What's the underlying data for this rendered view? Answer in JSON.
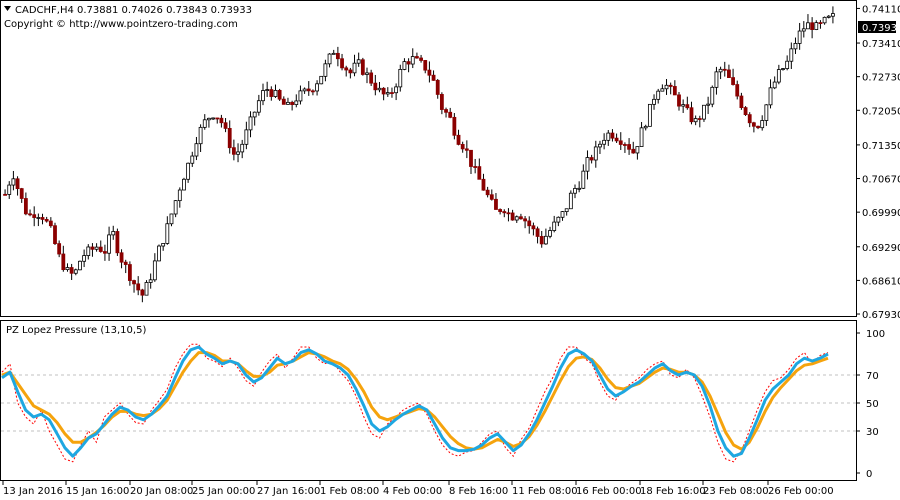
{
  "header": {
    "symbol_line": "CADCHF,H4  0.73881 0.74026 0.73843 0.73933",
    "copyright": "Copyright © http://www.pointzero-trading.com"
  },
  "price_badge": "0.73933",
  "indicator_title": "PZ Lopez Pressure (13,10,5)",
  "colors": {
    "candle_up": "#000000",
    "candle_down": "#8b0000",
    "fast_line": "#1ea7e1",
    "slow_line": "#f5a30d",
    "signal_dots": "#ff0000",
    "level_lines": "#c0c0c0"
  },
  "chart_data": [
    {
      "type": "candlestick",
      "title": "CADCHF,H4",
      "ohlc_last": {
        "open": 0.73881,
        "high": 0.74026,
        "low": 0.73843,
        "close": 0.73933
      },
      "ylim": [
        0.6789,
        0.7424
      ],
      "y_ticks": [
        "0.74110",
        "0.73410",
        "0.72730",
        "0.72050",
        "0.71350",
        "0.70670",
        "0.69990",
        "0.69290",
        "0.68610",
        "0.67930"
      ],
      "y_tick_values": [
        0.7411,
        0.7341,
        0.7273,
        0.7205,
        0.7135,
        0.7067,
        0.6999,
        0.6929,
        0.6861,
        0.6793
      ],
      "x_ticks": [
        "13 Jan 2016",
        "15 Jan 16:00",
        "20 Jan 08:00",
        "25 Jan 00:00",
        "27 Jan 16:00",
        "1 Feb 08:00",
        "4 Feb 00:00",
        "8 Feb 16:00",
        "11 Feb 08:00",
        "16 Feb 00:00",
        "18 Feb 16:00",
        "23 Feb 08:00",
        "26 Feb 00:00"
      ],
      "close_path": [
        0.7035,
        0.708,
        0.703,
        0.699,
        0.7,
        0.699,
        0.696,
        0.691,
        0.688,
        0.687,
        0.691,
        0.692,
        0.693,
        0.692,
        0.696,
        0.691,
        0.688,
        0.685,
        0.683,
        0.687,
        0.692,
        0.696,
        0.701,
        0.706,
        0.71,
        0.715,
        0.718,
        0.72,
        0.719,
        0.715,
        0.711,
        0.714,
        0.718,
        0.722,
        0.725,
        0.724,
        0.722,
        0.721,
        0.723,
        0.724,
        0.725,
        0.727,
        0.73,
        0.733,
        0.73,
        0.728,
        0.73,
        0.728,
        0.726,
        0.724,
        0.723,
        0.726,
        0.73,
        0.731,
        0.73,
        0.729,
        0.726,
        0.721,
        0.719,
        0.715,
        0.713,
        0.709,
        0.706,
        0.703,
        0.7,
        0.701,
        0.699,
        0.7,
        0.698,
        0.696,
        0.694,
        0.696,
        0.698,
        0.7,
        0.704,
        0.706,
        0.71,
        0.712,
        0.715,
        0.716,
        0.715,
        0.714,
        0.712,
        0.716,
        0.72,
        0.725,
        0.726,
        0.724,
        0.722,
        0.72,
        0.718,
        0.72,
        0.723,
        0.729,
        0.728,
        0.725,
        0.722,
        0.719,
        0.717,
        0.72,
        0.725,
        0.728,
        0.73,
        0.734,
        0.737,
        0.738,
        0.737,
        0.7385,
        0.7393
      ]
    },
    {
      "type": "line",
      "title": "PZ Lopez Pressure (13,10,5)",
      "ylim": [
        0,
        100
      ],
      "y_ticks": [
        "100",
        "70",
        "50",
        "30",
        "0"
      ],
      "y_tick_values": [
        100,
        70,
        50,
        30,
        0
      ],
      "levels": [
        70,
        50,
        30
      ],
      "series": [
        {
          "values": [
            68,
            72,
            58,
            45,
            40,
            42,
            38,
            28,
            18,
            12,
            18,
            25,
            28,
            35,
            42,
            47,
            45,
            40,
            38,
            42,
            48,
            55,
            68,
            80,
            88,
            90,
            85,
            82,
            78,
            80,
            78,
            70,
            65,
            68,
            75,
            82,
            78,
            80,
            86,
            88,
            85,
            80,
            78,
            75,
            70,
            60,
            48,
            35,
            30,
            33,
            38,
            42,
            45,
            48,
            45,
            35,
            25,
            18,
            16,
            16,
            17,
            20,
            25,
            28,
            22,
            16,
            20,
            28,
            38,
            50,
            62,
            75,
            85,
            88,
            85,
            80,
            70,
            60,
            55,
            58,
            62,
            65,
            70,
            75,
            78,
            73,
            70,
            72,
            70,
            62,
            48,
            30,
            18,
            12,
            14,
            25,
            38,
            52,
            60,
            65,
            70,
            78,
            82,
            80,
            82,
            85
          ]
        },
        {
          "values": [
            70,
            72,
            64,
            56,
            48,
            45,
            42,
            36,
            28,
            22,
            22,
            25,
            29,
            34,
            40,
            44,
            44,
            42,
            41,
            42,
            46,
            52,
            62,
            72,
            80,
            86,
            86,
            84,
            80,
            80,
            78,
            73,
            69,
            69,
            72,
            77,
            78,
            80,
            83,
            86,
            85,
            83,
            80,
            78,
            74,
            67,
            58,
            47,
            40,
            38,
            40,
            42,
            44,
            46,
            45,
            40,
            33,
            26,
            21,
            18,
            17,
            18,
            21,
            24,
            22,
            19,
            21,
            26,
            34,
            44,
            55,
            66,
            76,
            82,
            83,
            81,
            75,
            67,
            61,
            60,
            62,
            64,
            68,
            72,
            75,
            74,
            72,
            72,
            70,
            65,
            55,
            42,
            29,
            20,
            17,
            22,
            32,
            44,
            54,
            61,
            67,
            73,
            77,
            78,
            80,
            82
          ]
        },
        {
          "values": [
            72,
            78,
            50,
            40,
            35,
            45,
            30,
            20,
            10,
            8,
            20,
            30,
            22,
            40,
            45,
            50,
            42,
            36,
            35,
            45,
            52,
            60,
            75,
            85,
            92,
            92,
            82,
            80,
            76,
            82,
            75,
            66,
            62,
            72,
            80,
            85,
            75,
            82,
            90,
            90,
            82,
            78,
            80,
            72,
            66,
            55,
            40,
            28,
            25,
            35,
            40,
            45,
            48,
            50,
            42,
            30,
            20,
            14,
            12,
            15,
            16,
            22,
            28,
            30,
            18,
            12,
            24,
            32,
            45,
            58,
            68,
            82,
            90,
            90,
            82,
            78,
            65,
            55,
            52,
            60,
            64,
            68,
            74,
            78,
            80,
            70,
            68,
            74,
            68,
            55,
            40,
            22,
            10,
            8,
            16,
            30,
            45,
            58,
            66,
            68,
            74,
            82,
            86,
            78,
            84,
            86
          ]
        }
      ]
    }
  ]
}
